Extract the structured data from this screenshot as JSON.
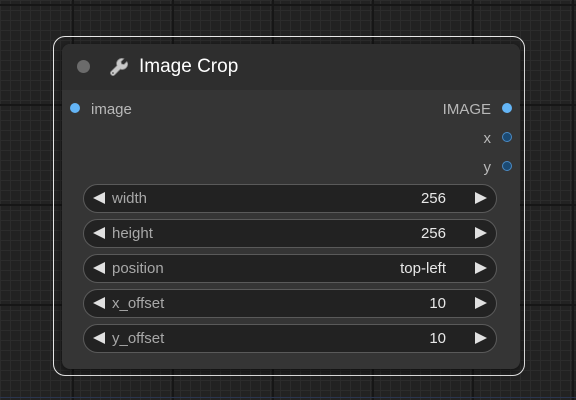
{
  "node": {
    "title": "Image Crop",
    "title_icon": "wrench-icon",
    "inputs": [
      {
        "label": "image",
        "color": "#64b5f6"
      }
    ],
    "outputs": [
      {
        "label": "IMAGE",
        "color": "#64b5f6"
      },
      {
        "label": "x",
        "color": "#4a8ac4"
      },
      {
        "label": "y",
        "color": "#4a8ac4"
      }
    ],
    "widgets": [
      {
        "name": "width",
        "value": "256"
      },
      {
        "name": "height",
        "value": "256"
      },
      {
        "name": "position",
        "value": "top-left"
      },
      {
        "name": "x_offset",
        "value": "10"
      },
      {
        "name": "y_offset",
        "value": "10"
      }
    ]
  }
}
